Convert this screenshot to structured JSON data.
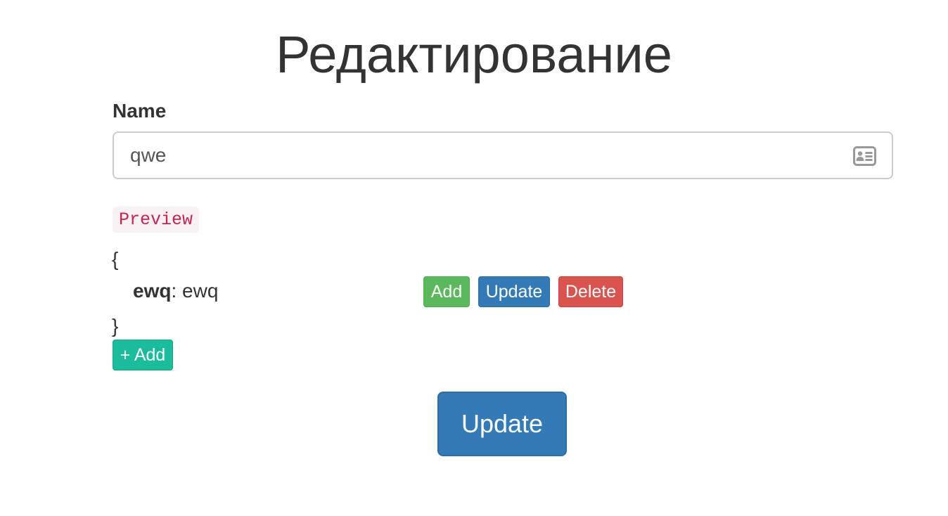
{
  "page": {
    "title": "Редактирование"
  },
  "form": {
    "name_label": "Name",
    "name_value": "qwe",
    "name_icon": "contact-card-icon"
  },
  "preview": {
    "label": "Preview",
    "open_brace": "{",
    "close_brace": "}",
    "entries": [
      {
        "key": "ewq",
        "separator": ":",
        "value": "ewq"
      }
    ]
  },
  "row_actions": {
    "add_label": "Add",
    "update_label": "Update",
    "delete_label": "Delete"
  },
  "add_field_label": "+ Add",
  "submit_label": "Update",
  "colors": {
    "primary": "#337ab7",
    "success": "#5cb85c",
    "danger": "#d9534f",
    "teal": "#1abc9c",
    "code_text": "#c7254e",
    "code_bg": "#f9f2f4"
  }
}
